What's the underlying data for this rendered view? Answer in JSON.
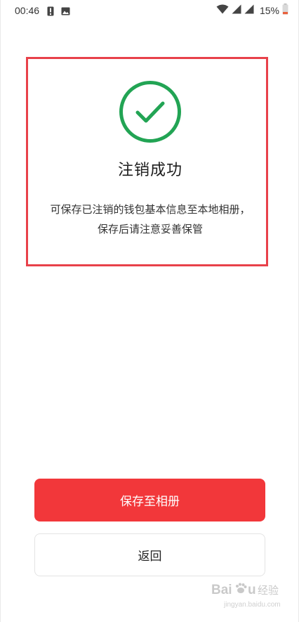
{
  "status_bar": {
    "time": "00:46",
    "battery": "15%",
    "icons": [
      "alert-icon",
      "image-icon",
      "wifi-icon",
      "signal-icon",
      "signal-icon",
      "battery-icon"
    ]
  },
  "success": {
    "icon": "check-circle-icon",
    "title": "注销成功",
    "description_line1": "可保存已注销的钱包基本信息至本地相册，",
    "description_line2": "保存后请注意妥善保管"
  },
  "actions": {
    "save_label": "保存至相册",
    "back_label": "返回"
  },
  "watermark": {
    "text": "Baidu 经验",
    "url": "jingyan.baidu.com"
  },
  "colors": {
    "accent_red": "#f2373a",
    "success_green": "#22a454",
    "highlight_border": "#e8414a"
  }
}
